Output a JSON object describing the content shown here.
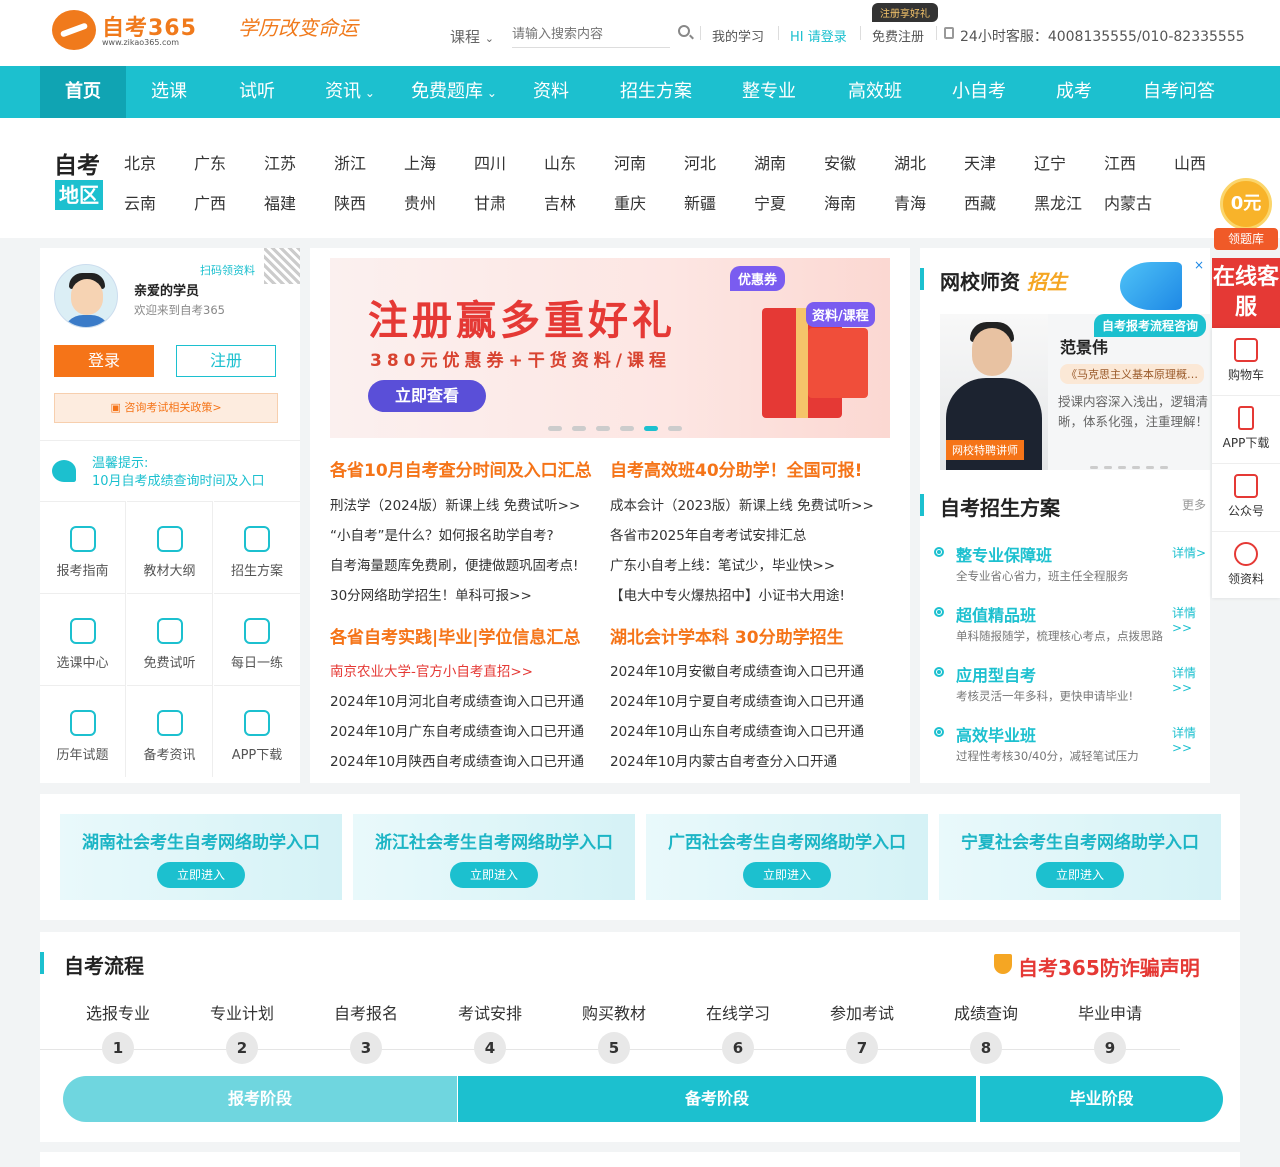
{
  "header": {
    "logo_text": "自考365",
    "logo_url_text": "www.zikao365.com",
    "slogan": "学历改变命运",
    "course_select": "课程",
    "search_placeholder": "请输入搜索内容",
    "my_study": "我的学习",
    "login_prompt": "HI 请登录",
    "register": "免费注册",
    "gift_tag": "注册享好礼",
    "hotline": "24小时客服：4008135555/010-82335555"
  },
  "nav": [
    "首页",
    "选课",
    "试听",
    "资讯",
    "免费题库",
    "资料",
    "招生方案",
    "整专业",
    "高效班",
    "小自考",
    "成考",
    "自考问答"
  ],
  "region": {
    "title1": "自考",
    "title2": "地区",
    "row1": [
      "北京",
      "广东",
      "江苏",
      "浙江",
      "上海",
      "四川",
      "山东",
      "河南",
      "河北",
      "湖南",
      "安徽",
      "湖北",
      "天津",
      "辽宁",
      "江西",
      "山西"
    ],
    "row2": [
      "云南",
      "广西",
      "福建",
      "陕西",
      "贵州",
      "甘肃",
      "吉林",
      "重庆",
      "新疆",
      "宁夏",
      "海南",
      "青海",
      "西藏",
      "黑龙江",
      "内蒙古"
    ]
  },
  "user": {
    "qr_label": "扫码领资料",
    "greeting": "亲爱的学员",
    "welcome": "欢迎来到自考365",
    "login": "登录",
    "register": "注册",
    "consult": "咨询考试相关政策>",
    "tip_label": "温馨提示:",
    "tip_text": "10月自考成绩查询时间及入口",
    "grid": [
      "报考指南",
      "教材大纲",
      "招生方案",
      "选课中心",
      "免费试听",
      "每日一练",
      "历年试题",
      "备考资讯",
      "APP下载"
    ]
  },
  "banner": {
    "title": "注册赢多重好礼",
    "subtitle": "380元优惠券+干货资料/课程",
    "button": "立即查看",
    "badge_coupon": "优惠券",
    "badge_res": "资料/课程"
  },
  "news": {
    "col1_head1": "各省10月自考查分时间及入口汇总",
    "col1_items1": [
      "刑法学（2024版）新课上线 免费试听>>",
      "“小自考”是什么？如何报名助学自考?",
      "自考海量题库免费刷，便捷做题巩固考点!",
      "30分网络助学招生！单科可报>>"
    ],
    "col2_head1": "自考高效班40分助学！全国可报!",
    "col2_items1": [
      "成本会计（2023版）新课上线 免费试听>>",
      "各省市2025年自考考试安排汇总",
      "广东小自考上线：笔试少，毕业快>>",
      "【电大中专火爆热招中】小证书大用途!"
    ],
    "col1_head2": "各省自考实践|毕业|学位信息汇总",
    "col1_items2": [
      "南京农业大学-官方小自考直招>>",
      "2024年10月河北自考成绩查询入口已开通",
      "2024年10月广东自考成绩查询入口已开通",
      "2024年10月陕西自考成绩查询入口已开通"
    ],
    "col2_head2": "湖北会计学本科 30分助学招生",
    "col2_items2": [
      "2024年10月安徽自考成绩查询入口已开通",
      "2024年10月宁夏自考成绩查询入口已开通",
      "2024年10月山东自考成绩查询入口已开通",
      "2024年10月内蒙古自考查分入口开通"
    ]
  },
  "teachers": {
    "title": "网校师资",
    "title_hl": "招生",
    "consult_badge": "自考报考流程咨询",
    "close": "×",
    "name": "范景伟",
    "course": "《马克思主义基本原理概…",
    "desc": "授课内容深入浅出，逻辑清晰，体系化强，注重理解！",
    "tag": "网校特聘讲师"
  },
  "plans": {
    "title": "自考招生方案",
    "more": "更多",
    "items": [
      {
        "title": "整专业保障班",
        "desc": "全专业省心省力，班主任全程服务",
        "more": "详情>"
      },
      {
        "title": "超值精品班",
        "desc": "单科随报随学，梳理核心考点，点拨思路",
        "more": "详情>>"
      },
      {
        "title": "应用型自考",
        "desc": "考核灵活一年多科，更快申请毕业!",
        "more": "详情>>"
      },
      {
        "title": "高效毕业班",
        "desc": "过程性考核30/40分，减轻笔试压力",
        "more": "详情>>"
      }
    ]
  },
  "side": {
    "coin": "0元",
    "coin_label": "领题库",
    "kefu": "在线客服",
    "items": [
      "购物车",
      "APP下载",
      "公众号",
      "领资料"
    ]
  },
  "entrance": {
    "cards": [
      "湖南社会考生自考网络助学入口",
      "浙江社会考生自考网络助学入口",
      "广西社会考生自考网络助学入口",
      "宁夏社会考生自考网络助学入口"
    ],
    "button": "立即进入"
  },
  "process": {
    "title": "自考流程",
    "fraud": "自考365防诈骗声明",
    "steps": [
      "选报专业",
      "专业计划",
      "自考报名",
      "考试安排",
      "购买教材",
      "在线学习",
      "参加考试",
      "成绩查询",
      "毕业申请"
    ],
    "nums": [
      "1",
      "2",
      "3",
      "4",
      "5",
      "6",
      "7",
      "8",
      "9"
    ],
    "phases": [
      "报考阶段",
      "备考阶段",
      "毕业阶段"
    ]
  },
  "colors": {
    "accent": "#1cc0cf",
    "orange": "#f57418",
    "red": "#e53935"
  }
}
